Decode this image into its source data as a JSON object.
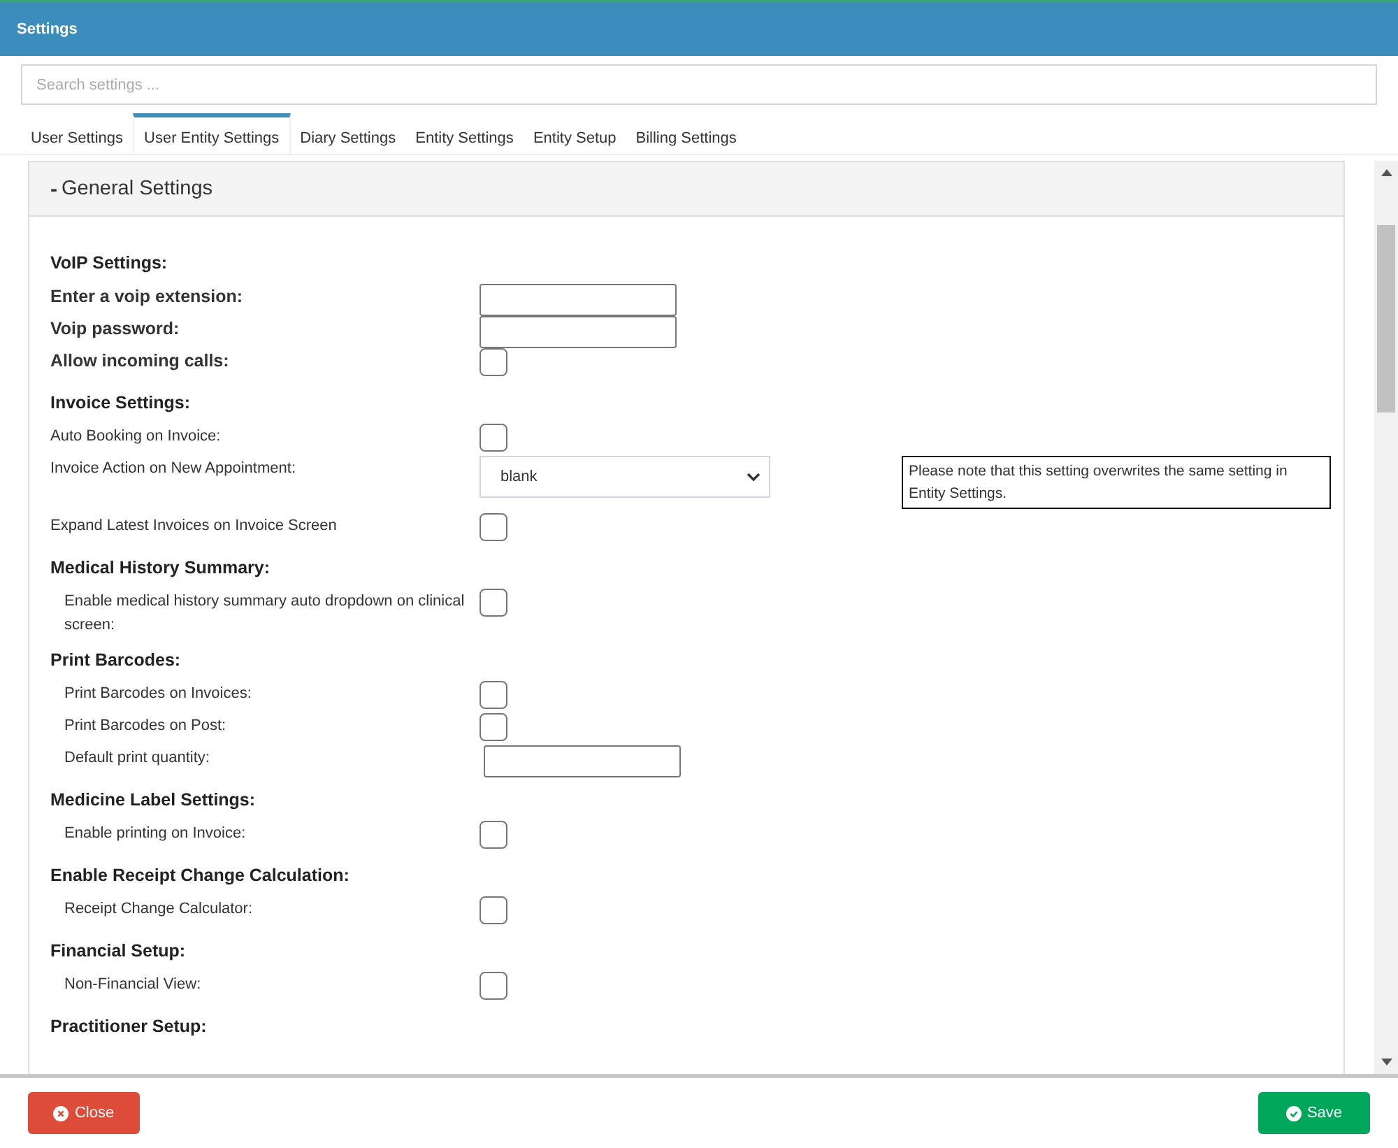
{
  "window": {
    "title": "Settings"
  },
  "search": {
    "placeholder": "Search settings ..."
  },
  "tabs": [
    {
      "label": "User Settings",
      "selected": false
    },
    {
      "label": "User Entity Settings",
      "selected": true
    },
    {
      "label": "Diary Settings",
      "selected": false
    },
    {
      "label": "Entity Settings",
      "selected": false
    },
    {
      "label": "Entity Setup",
      "selected": false
    },
    {
      "label": "Billing Settings",
      "selected": false
    }
  ],
  "panel": {
    "toggle": "-",
    "title": "General Settings"
  },
  "sections": [
    {
      "heading": "VoIP Settings:",
      "kind": "bold",
      "rows": [
        {
          "label": "Enter a voip extension:",
          "kind": "text"
        },
        {
          "label": "Voip password:",
          "kind": "text"
        },
        {
          "label": "Allow incoming calls:",
          "kind": "checkbox",
          "checked": false
        }
      ]
    },
    {
      "heading": "Invoice Settings:",
      "kind": "plain",
      "rows": [
        {
          "label": "Auto Booking on Invoice:",
          "kind": "checkbox",
          "checked": false
        },
        {
          "label": "Invoice Action on New Appointment:",
          "kind": "select",
          "value": "blank",
          "note": "Please note that this setting overwrites the same setting in Entity Settings."
        },
        {
          "label": "Expand Latest Invoices on Invoice Screen",
          "kind": "checkbox",
          "checked": false
        }
      ]
    },
    {
      "heading": "Medical History Summary:",
      "kind": "indented",
      "rows": [
        {
          "label": "Enable medical history summary auto dropdown on clinical screen:",
          "kind": "checkbox",
          "checked": false
        }
      ]
    },
    {
      "heading": "Print Barcodes:",
      "kind": "indented",
      "rows": [
        {
          "label": "Print Barcodes on Invoices:",
          "kind": "checkbox",
          "checked": false
        },
        {
          "label": "Print Barcodes on Post:",
          "kind": "checkbox",
          "checked": false
        },
        {
          "label": "Default print quantity:",
          "kind": "text"
        }
      ]
    },
    {
      "heading": "Medicine Label Settings:",
      "kind": "indented",
      "rows": [
        {
          "label": "Enable printing on Invoice:",
          "kind": "checkbox",
          "checked": false
        }
      ]
    },
    {
      "heading": "Enable Receipt Change Calculation:",
      "kind": "indented",
      "rows": [
        {
          "label": "Receipt Change Calculator:",
          "kind": "checkbox",
          "checked": false
        }
      ]
    },
    {
      "heading": "Financial Setup:",
      "kind": "indented",
      "rows": [
        {
          "label": "Non-Financial View:",
          "kind": "checkbox",
          "checked": false
        }
      ]
    },
    {
      "heading": "Practitioner Setup:",
      "kind": "indented"
    }
  ],
  "buttons": [
    {
      "label": "Close",
      "kind": "close"
    },
    {
      "label": "Save",
      "kind": "save"
    }
  ]
}
